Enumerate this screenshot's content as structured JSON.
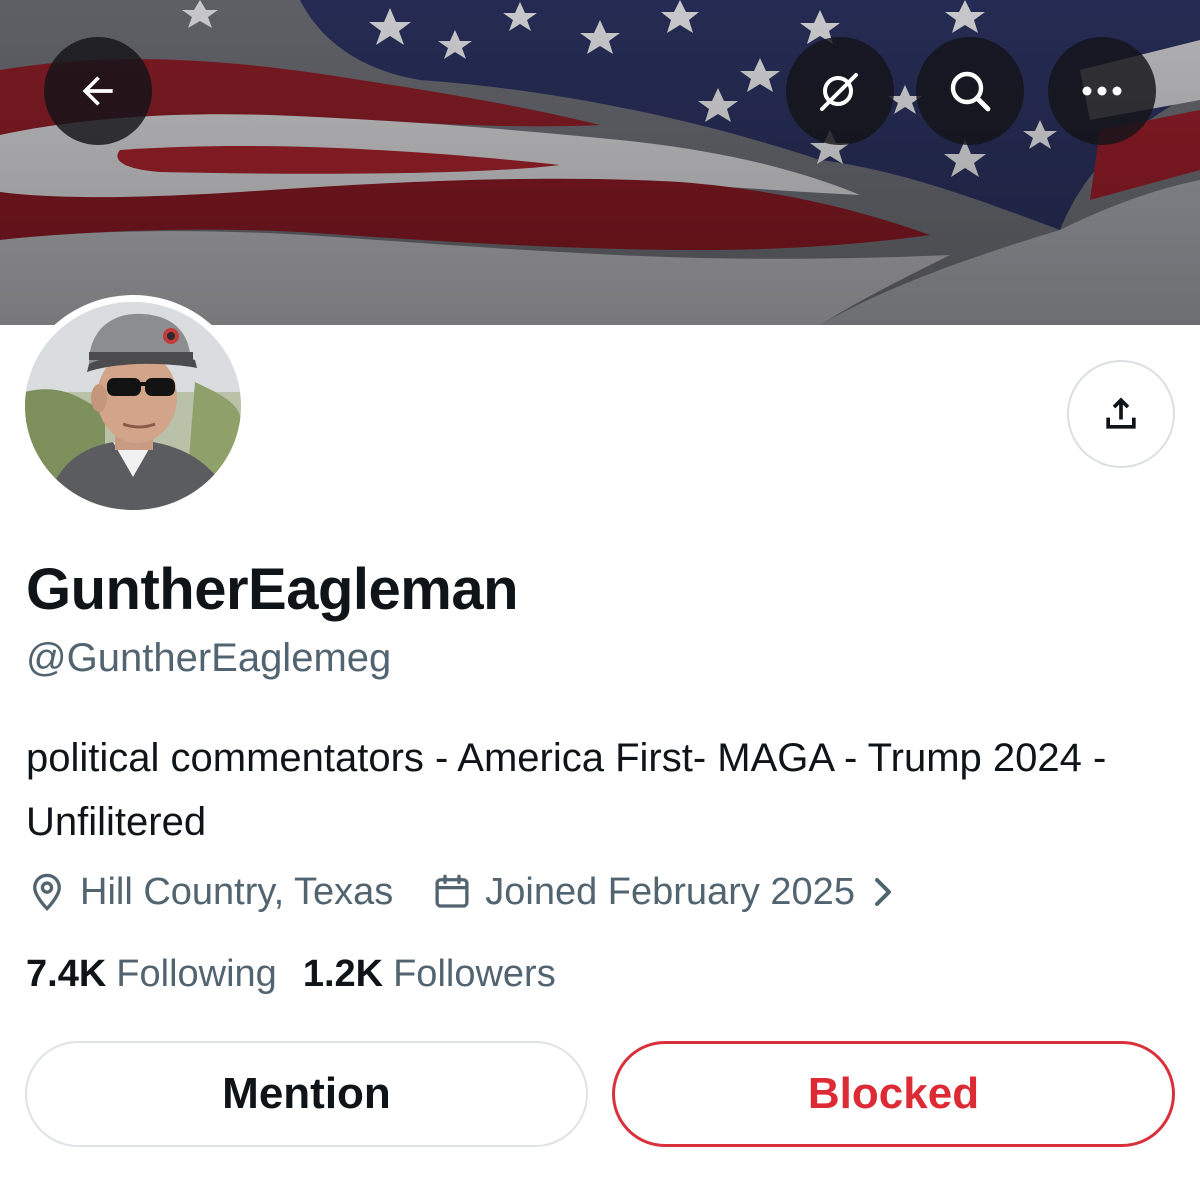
{
  "header": {
    "back_icon": "arrow-left-icon",
    "grok_icon": "grok-icon",
    "search_icon": "search-icon",
    "more_icon": "more-horizontal-icon",
    "banner_image": "american-flag-banner"
  },
  "profile": {
    "display_name": "GuntherEagleman",
    "handle": "@GuntherEaglemeg",
    "bio": "political commentators - America First- MAGA - Trump 2024 - Unfilitered",
    "location": "Hill Country, Texas",
    "joined": "Joined February 2025",
    "avatar": "profile-photo-man-in-cap-and-sunglasses"
  },
  "stats": {
    "following_count": "7.4K",
    "following_label": "Following",
    "followers_count": "1.2K",
    "followers_label": "Followers"
  },
  "actions": {
    "mention_label": "Mention",
    "blocked_label": "Blocked",
    "share_icon": "share-icon"
  },
  "colors": {
    "text_primary": "#0f1419",
    "text_secondary": "#536471",
    "blocked_red": "#dd2b35",
    "border": "#dde3e7"
  }
}
